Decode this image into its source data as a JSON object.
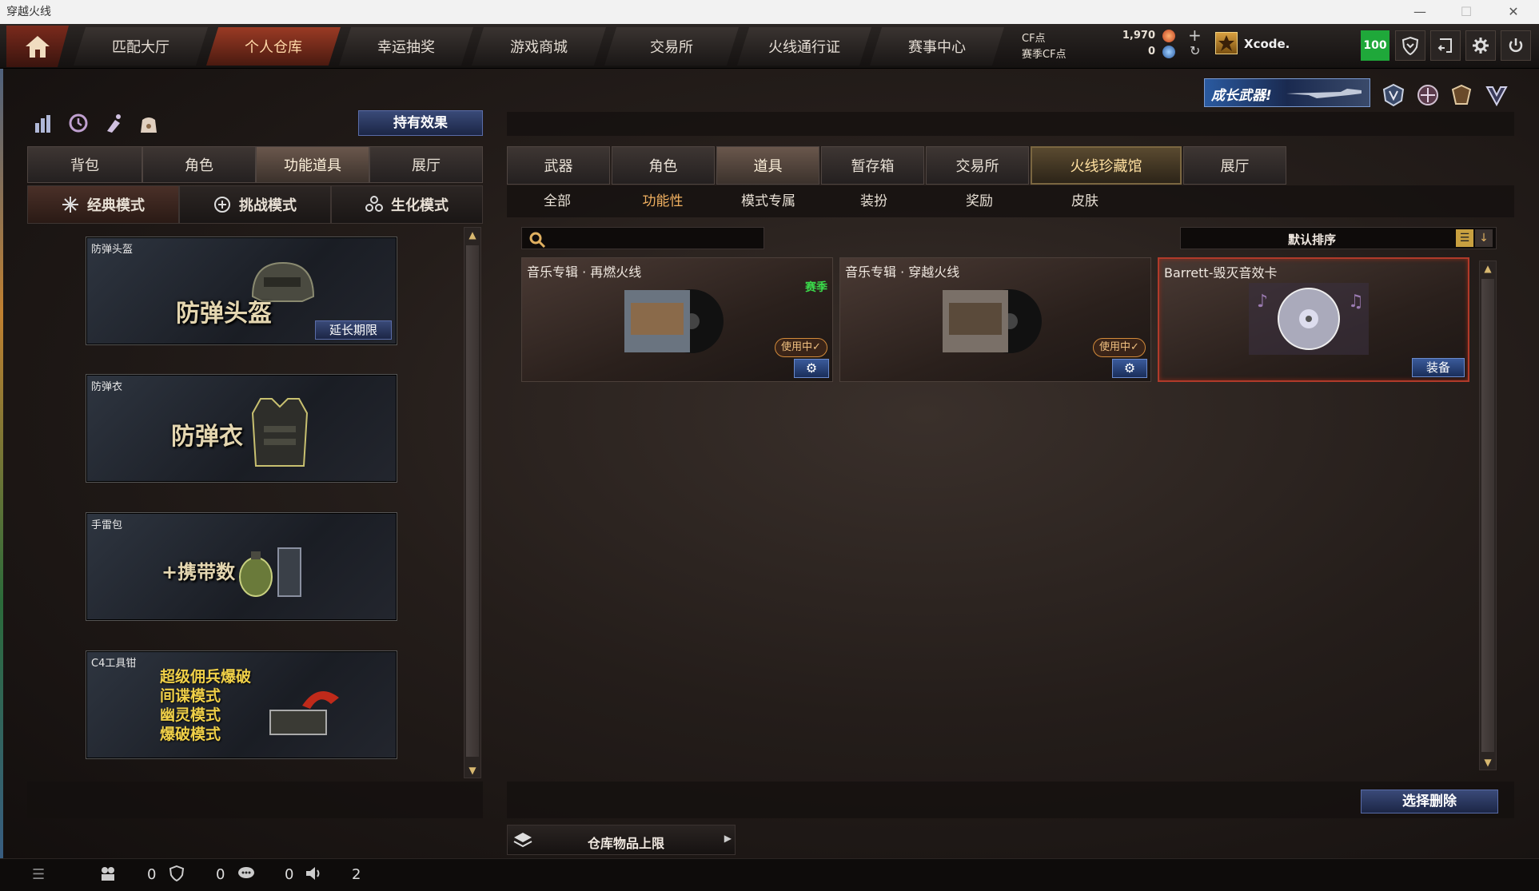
{
  "window": {
    "title": "穿越火线",
    "minimize": "—",
    "maximize": "☐",
    "close": "✕"
  },
  "nav": {
    "tabs": [
      "匹配大厅",
      "个人仓库",
      "幸运抽奖",
      "游戏商城",
      "交易所",
      "火线通行证",
      "赛事中心"
    ],
    "active": "个人仓库"
  },
  "currency": {
    "cf_label": "CF点",
    "cf_value": "1,970",
    "season_label": "赛季CF点",
    "season_value": "0",
    "plus": "+",
    "refresh": "↻"
  },
  "user": {
    "name": "Xcode.",
    "level": "100"
  },
  "banner": {
    "text": "成长武器!"
  },
  "left_panel": {
    "effects_button": "持有效果",
    "tabs": [
      "背包",
      "角色",
      "功能道具",
      "展厅"
    ],
    "active_tab": "功能道具",
    "modes": [
      "经典模式",
      "挑战模式",
      "生化模式"
    ],
    "active_mode": "经典模式",
    "items": [
      {
        "title": "防弹头盔",
        "big": "防弹头盔",
        "action": "延长期限"
      },
      {
        "title": "防弹衣",
        "big": "防弹衣"
      },
      {
        "title": "手雷包",
        "big": "+携带数"
      },
      {
        "title": "C4工具钳",
        "lines": [
          "超级佣兵爆破",
          "间谍模式",
          "幽灵模式",
          "爆破模式"
        ]
      }
    ]
  },
  "right_panel": {
    "tabs": [
      "武器",
      "角色",
      "道具",
      "暂存箱",
      "交易所",
      "火线珍藏馆",
      "展厅"
    ],
    "active_tab": "道具",
    "special_tab": "火线珍藏馆",
    "subtabs": [
      "全部",
      "功能性",
      "模式专属",
      "装扮",
      "奖励",
      "皮肤"
    ],
    "active_subtab": "功能性",
    "search": {
      "placeholder": ""
    },
    "sort_label": "默认排序",
    "cards": [
      {
        "title": "音乐专辑 · 再燃火线",
        "tag": "赛季",
        "status": "使用中✓"
      },
      {
        "title": "音乐专辑 · 穿越火线",
        "status": "使用中✓"
      },
      {
        "title": "Barrett-毁灭音效卡",
        "action": "装备"
      }
    ],
    "delete_button": "选择删除",
    "storage_label": "仓库物品上限"
  },
  "bottom": {
    "stat1": "0",
    "stat2": "0",
    "stat3": "0",
    "stat4": "2"
  },
  "colors": {
    "accent_red": "#9a3a24",
    "gold": "#f0b060",
    "button_blue": "#3a4a78",
    "level_green": "#1fa83a"
  }
}
